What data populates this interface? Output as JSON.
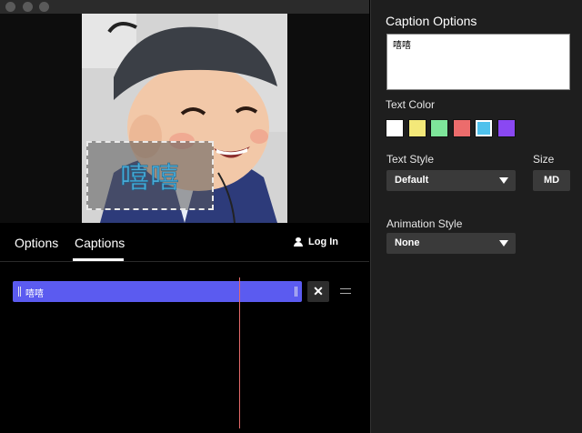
{
  "window": {
    "traffic_lights": [
      "close",
      "minimize",
      "zoom"
    ]
  },
  "preview": {
    "caption_text": "嘻嘻",
    "caption_color": "#4aa9d6"
  },
  "tabs": [
    {
      "label": "Options",
      "active": false
    },
    {
      "label": "Captions",
      "active": true
    }
  ],
  "login": {
    "label": "Log In",
    "icon": "user-icon"
  },
  "timeline": {
    "clip_label": "嘻嘻",
    "clip_color": "#5b5bf0",
    "delete_glyph": "✕",
    "playhead_color": "#e36a6a"
  },
  "panel": {
    "title": "Caption Options",
    "caption_input_value": "嘻嘻",
    "text_color_label": "Text Color",
    "swatches": [
      "#ffffff",
      "#f3e879",
      "#7ee59a",
      "#ec6c6c",
      "#4ec1ec",
      "#8a48f2"
    ],
    "selected_swatch": "#4ec1ec",
    "text_style_label": "Text Style",
    "text_style_value": "Default",
    "size_label": "Size",
    "size_value": "MD",
    "animation_style_label": "Animation Style",
    "animation_style_value": "None"
  }
}
